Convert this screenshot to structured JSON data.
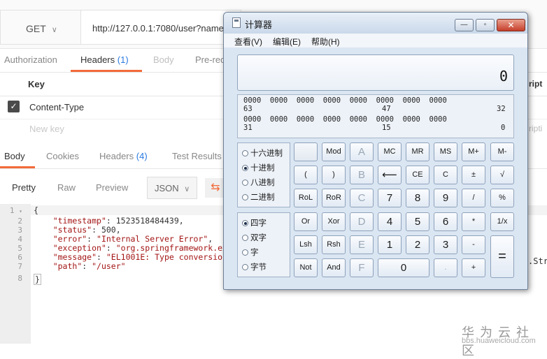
{
  "request": {
    "method": "GET",
    "url": "http://127.0.0.1:7080/user?name"
  },
  "request_tabs": [
    {
      "label": "Authorization"
    },
    {
      "label": "Headers",
      "count": "(1)"
    },
    {
      "label": "Body"
    },
    {
      "label": "Pre-req"
    }
  ],
  "headers_table": {
    "key_header": "Key",
    "desc_header": "ript",
    "rows": [
      {
        "key": "Content-Type",
        "checked": true,
        "desc": ""
      },
      {
        "key": "New key",
        "placeholder": true,
        "desc": "ripti"
      }
    ]
  },
  "response_tabs": [
    {
      "label": "Body"
    },
    {
      "label": "Cookies"
    },
    {
      "label": "Headers",
      "count": "(4)"
    },
    {
      "label": "Test Results"
    }
  ],
  "view_modes": [
    "Pretty",
    "Raw",
    "Preview"
  ],
  "format_select": "JSON",
  "wrap_icon": "wrap-lines-icon",
  "code_lines": [
    {
      "n": "1",
      "text": "{"
    },
    {
      "n": "2",
      "key": "\"timestamp\"",
      "val": "1523518484439",
      "comma": ","
    },
    {
      "n": "3",
      "key": "\"status\"",
      "val": "500",
      "comma": ","
    },
    {
      "n": "4",
      "key": "\"error\"",
      "val": "\"Internal Server Error\"",
      "comma": ","
    },
    {
      "n": "5",
      "key": "\"exception\"",
      "val": "\"org.springframework.ex"
    },
    {
      "n": "6",
      "key": "\"message\"",
      "val": "\"EL1001E: Type conversion"
    },
    {
      "n": "7",
      "key": "\"path\"",
      "val": "\"/user\""
    },
    {
      "n": "8",
      "text": "}"
    }
  ],
  "overflow_text": ".Str",
  "watermark": {
    "brand": "华为云社区",
    "url": "bbs.huaweicloud.com"
  },
  "calculator": {
    "title": "计算器",
    "menus": [
      "查看(V)",
      "编辑(E)",
      "帮助(H)"
    ],
    "window_buttons": {
      "minimize": "—",
      "maximize": "▫",
      "close": "✕"
    },
    "display": "0",
    "bits": {
      "row1": "0000  0000  0000  0000  0000  0000  0000  0000",
      "row1_sub_left": "63",
      "row1_sub_mid": "47",
      "row1_sub_right": "32",
      "row2": "0000  0000  0000  0000  0000  0000  0000  0000",
      "row2_sub_left": "31",
      "row2_sub_mid": "15",
      "row2_sub_right": "0"
    },
    "base_options": [
      {
        "label": "十六进制",
        "selected": false
      },
      {
        "label": "十进制",
        "selected": true
      },
      {
        "label": "八进制",
        "selected": false
      },
      {
        "label": "二进制",
        "selected": false
      }
    ],
    "word_options": [
      {
        "label": "四字",
        "selected": true
      },
      {
        "label": "双字",
        "selected": false
      },
      {
        "label": "字",
        "selected": false
      },
      {
        "label": "字节",
        "selected": false
      }
    ],
    "keys": {
      "mod": "Mod",
      "a": "A",
      "mc": "MC",
      "mr": "MR",
      "ms": "MS",
      "mplus": "M+",
      "mminus": "M-",
      "lparen": "(",
      "rparen": ")",
      "b": "B",
      "back": "⟵",
      "ce": "CE",
      "c": "C",
      "plusminus": "±",
      "sqrt": "√",
      "rol": "RoL",
      "ror": "RoR",
      "c_hex": "C",
      "k7": "7",
      "k8": "8",
      "k9": "9",
      "div": "/",
      "pct": "%",
      "or": "Or",
      "xor": "Xor",
      "d": "D",
      "k4": "4",
      "k5": "5",
      "k6": "6",
      "mul": "*",
      "recip": "1/x",
      "lsh": "Lsh",
      "rsh": "Rsh",
      "e": "E",
      "k1": "1",
      "k2": "2",
      "k3": "3",
      "minus": "-",
      "equals": "=",
      "not": "Not",
      "and": "And",
      "f": "F",
      "k0": "0",
      "dot": ".",
      "plus": "+"
    }
  }
}
